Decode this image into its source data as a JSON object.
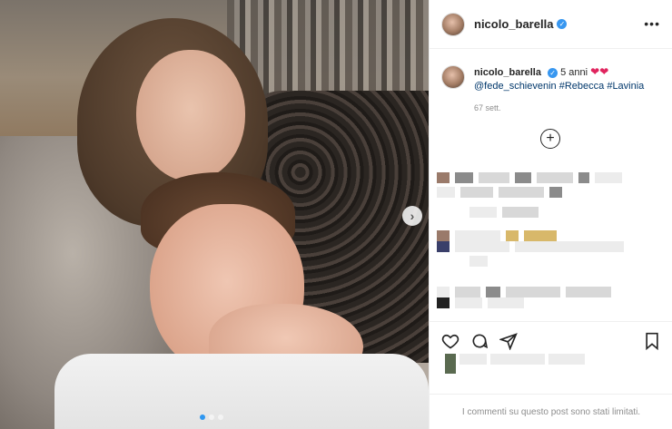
{
  "post": {
    "username": "nicolo_barella",
    "verified_icon": "verified-badge-icon",
    "more_icon": "more-options-icon",
    "more_label": "•••"
  },
  "caption": {
    "username": "nicolo_barella",
    "text": "5 anni",
    "hearts": "❤❤",
    "mention": "@fede_schievenin",
    "hashtags": "#Rebecca #Lavinia",
    "time": "67 sett."
  },
  "comments": {
    "add_icon": "add-circle-icon",
    "add_label": "+"
  },
  "actions": {
    "like_icon": "heart-icon",
    "comment_icon": "comment-icon",
    "share_icon": "share-icon",
    "save_icon": "bookmark-icon"
  },
  "carousel": {
    "next_icon": "chevron-right-icon",
    "next_label": "›"
  },
  "footer": {
    "limited_text": "I commenti su questo post sono stati limitati."
  },
  "colors": {
    "verified": "#3897f0",
    "heart": "#e0245e",
    "link": "#00376b",
    "muted": "#8e8e8e"
  }
}
